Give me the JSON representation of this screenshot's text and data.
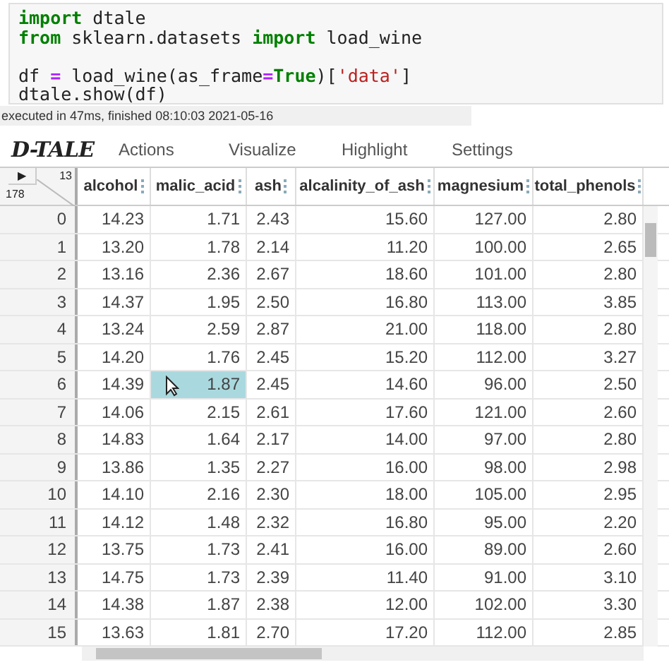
{
  "code_cell": {
    "lines": [
      {
        "gap_before": false,
        "tokens": [
          {
            "kind": "keyword",
            "text": "import"
          },
          {
            "kind": "plain",
            "text": " dtale"
          }
        ]
      },
      {
        "gap_before": false,
        "tokens": [
          {
            "kind": "keyword",
            "text": "from"
          },
          {
            "kind": "plain",
            "text": " sklearn.datasets "
          },
          {
            "kind": "keyword",
            "text": "import"
          },
          {
            "kind": "plain",
            "text": " load_wine"
          }
        ]
      },
      {
        "gap_before": true,
        "tokens": [
          {
            "kind": "plain",
            "text": "df "
          },
          {
            "kind": "operator",
            "text": "="
          },
          {
            "kind": "plain",
            "text": " load_wine(as_frame"
          },
          {
            "kind": "operator",
            "text": "="
          },
          {
            "kind": "keyword",
            "text": "True"
          },
          {
            "kind": "plain",
            "text": ")["
          },
          {
            "kind": "string",
            "text": "'data'"
          },
          {
            "kind": "plain",
            "text": "]"
          }
        ]
      },
      {
        "gap_before": false,
        "tokens": [
          {
            "kind": "plain",
            "text": "dtale.show(df)"
          }
        ]
      }
    ]
  },
  "execution_note": "executed in 47ms, finished 08:10:03 2021-05-16",
  "dtale": {
    "logo": "D-TALE",
    "menu": [
      "Actions",
      "Visualize",
      "Highlight",
      "Settings"
    ],
    "corner": {
      "play": "▶",
      "columns_count": "13",
      "rows_count": "178"
    },
    "columns": [
      "alcohol",
      "malic_acid",
      "ash",
      "alcalinity_of_ash",
      "magnesium",
      "total_phenols"
    ],
    "rows": [
      {
        "index": "0",
        "cells": [
          {
            "value": "14.23",
            "selected": false
          },
          {
            "value": "1.71",
            "selected": false
          },
          {
            "value": "2.43",
            "selected": false
          },
          {
            "value": "15.60",
            "selected": false
          },
          {
            "value": "127.00",
            "selected": false
          },
          {
            "value": "2.80",
            "selected": false
          }
        ]
      },
      {
        "index": "1",
        "cells": [
          {
            "value": "13.20",
            "selected": false
          },
          {
            "value": "1.78",
            "selected": false
          },
          {
            "value": "2.14",
            "selected": false
          },
          {
            "value": "11.20",
            "selected": false
          },
          {
            "value": "100.00",
            "selected": false
          },
          {
            "value": "2.65",
            "selected": false
          }
        ]
      },
      {
        "index": "2",
        "cells": [
          {
            "value": "13.16",
            "selected": false
          },
          {
            "value": "2.36",
            "selected": false
          },
          {
            "value": "2.67",
            "selected": false
          },
          {
            "value": "18.60",
            "selected": false
          },
          {
            "value": "101.00",
            "selected": false
          },
          {
            "value": "2.80",
            "selected": false
          }
        ]
      },
      {
        "index": "3",
        "cells": [
          {
            "value": "14.37",
            "selected": false
          },
          {
            "value": "1.95",
            "selected": false
          },
          {
            "value": "2.50",
            "selected": false
          },
          {
            "value": "16.80",
            "selected": false
          },
          {
            "value": "113.00",
            "selected": false
          },
          {
            "value": "3.85",
            "selected": false
          }
        ]
      },
      {
        "index": "4",
        "cells": [
          {
            "value": "13.24",
            "selected": false
          },
          {
            "value": "2.59",
            "selected": false
          },
          {
            "value": "2.87",
            "selected": false
          },
          {
            "value": "21.00",
            "selected": false
          },
          {
            "value": "118.00",
            "selected": false
          },
          {
            "value": "2.80",
            "selected": false
          }
        ]
      },
      {
        "index": "5",
        "cells": [
          {
            "value": "14.20",
            "selected": false
          },
          {
            "value": "1.76",
            "selected": false
          },
          {
            "value": "2.45",
            "selected": false
          },
          {
            "value": "15.20",
            "selected": false
          },
          {
            "value": "112.00",
            "selected": false
          },
          {
            "value": "3.27",
            "selected": false
          }
        ]
      },
      {
        "index": "6",
        "cells": [
          {
            "value": "14.39",
            "selected": false
          },
          {
            "value": "1.87",
            "selected": true
          },
          {
            "value": "2.45",
            "selected": false
          },
          {
            "value": "14.60",
            "selected": false
          },
          {
            "value": "96.00",
            "selected": false
          },
          {
            "value": "2.50",
            "selected": false
          }
        ]
      },
      {
        "index": "7",
        "cells": [
          {
            "value": "14.06",
            "selected": false
          },
          {
            "value": "2.15",
            "selected": false
          },
          {
            "value": "2.61",
            "selected": false
          },
          {
            "value": "17.60",
            "selected": false
          },
          {
            "value": "121.00",
            "selected": false
          },
          {
            "value": "2.60",
            "selected": false
          }
        ]
      },
      {
        "index": "8",
        "cells": [
          {
            "value": "14.83",
            "selected": false
          },
          {
            "value": "1.64",
            "selected": false
          },
          {
            "value": "2.17",
            "selected": false
          },
          {
            "value": "14.00",
            "selected": false
          },
          {
            "value": "97.00",
            "selected": false
          },
          {
            "value": "2.80",
            "selected": false
          }
        ]
      },
      {
        "index": "9",
        "cells": [
          {
            "value": "13.86",
            "selected": false
          },
          {
            "value": "1.35",
            "selected": false
          },
          {
            "value": "2.27",
            "selected": false
          },
          {
            "value": "16.00",
            "selected": false
          },
          {
            "value": "98.00",
            "selected": false
          },
          {
            "value": "2.98",
            "selected": false
          }
        ]
      },
      {
        "index": "10",
        "cells": [
          {
            "value": "14.10",
            "selected": false
          },
          {
            "value": "2.16",
            "selected": false
          },
          {
            "value": "2.30",
            "selected": false
          },
          {
            "value": "18.00",
            "selected": false
          },
          {
            "value": "105.00",
            "selected": false
          },
          {
            "value": "2.95",
            "selected": false
          }
        ]
      },
      {
        "index": "11",
        "cells": [
          {
            "value": "14.12",
            "selected": false
          },
          {
            "value": "1.48",
            "selected": false
          },
          {
            "value": "2.32",
            "selected": false
          },
          {
            "value": "16.80",
            "selected": false
          },
          {
            "value": "95.00",
            "selected": false
          },
          {
            "value": "2.20",
            "selected": false
          }
        ]
      },
      {
        "index": "12",
        "cells": [
          {
            "value": "13.75",
            "selected": false
          },
          {
            "value": "1.73",
            "selected": false
          },
          {
            "value": "2.41",
            "selected": false
          },
          {
            "value": "16.00",
            "selected": false
          },
          {
            "value": "89.00",
            "selected": false
          },
          {
            "value": "2.60",
            "selected": false
          }
        ]
      },
      {
        "index": "13",
        "cells": [
          {
            "value": "14.75",
            "selected": false
          },
          {
            "value": "1.73",
            "selected": false
          },
          {
            "value": "2.39",
            "selected": false
          },
          {
            "value": "11.40",
            "selected": false
          },
          {
            "value": "91.00",
            "selected": false
          },
          {
            "value": "3.10",
            "selected": false
          }
        ]
      },
      {
        "index": "14",
        "cells": [
          {
            "value": "14.38",
            "selected": false
          },
          {
            "value": "1.87",
            "selected": false
          },
          {
            "value": "2.38",
            "selected": false
          },
          {
            "value": "12.00",
            "selected": false
          },
          {
            "value": "102.00",
            "selected": false
          },
          {
            "value": "3.30",
            "selected": false
          }
        ]
      },
      {
        "index": "15",
        "cells": [
          {
            "value": "13.63",
            "selected": false
          },
          {
            "value": "1.81",
            "selected": false
          },
          {
            "value": "2.70",
            "selected": false
          },
          {
            "value": "17.20",
            "selected": false
          },
          {
            "value": "112.00",
            "selected": false
          },
          {
            "value": "2.85",
            "selected": false
          }
        ]
      }
    ]
  }
}
